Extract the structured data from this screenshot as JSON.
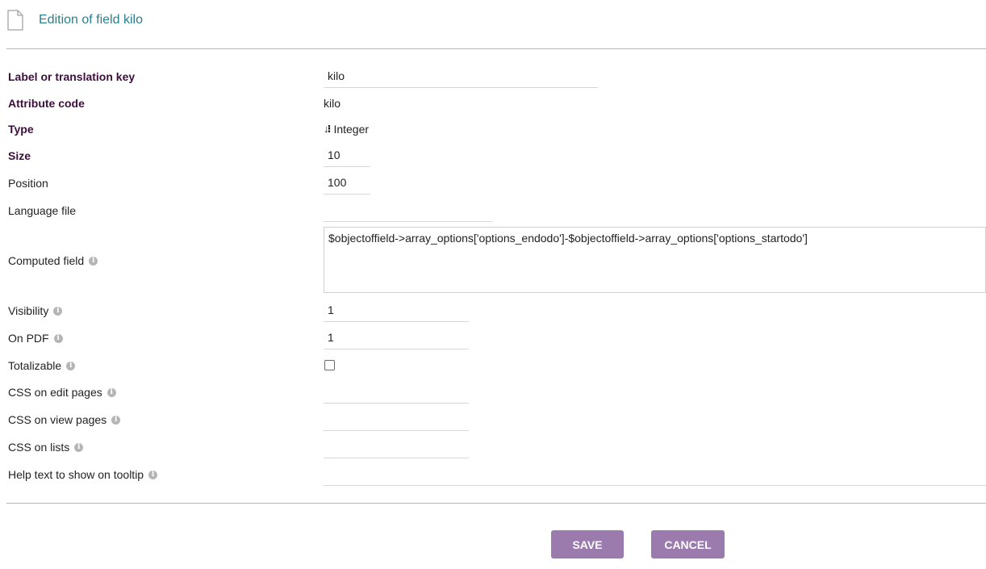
{
  "header": {
    "title": "Edition of field kilo",
    "icon": "document-icon"
  },
  "form": {
    "label_key": {
      "label": "Label or translation key",
      "value": "kilo"
    },
    "attribute_code": {
      "label": "Attribute code",
      "value": "kilo"
    },
    "type": {
      "label": "Type",
      "value": "Integer",
      "icon": "sort-numeric-icon"
    },
    "size": {
      "label": "Size",
      "value": "10"
    },
    "position": {
      "label": "Position",
      "value": "100"
    },
    "language_file": {
      "label": "Language file",
      "value": ""
    },
    "computed_field": {
      "label": "Computed field",
      "value": "$objectoffield->array_options['options_endodo']-$objectoffield->array_options['options_startodo']"
    },
    "visibility": {
      "label": "Visibility",
      "value": "1"
    },
    "on_pdf": {
      "label": "On PDF",
      "value": "1"
    },
    "totalizable": {
      "label": "Totalizable",
      "checked": false
    },
    "css_edit": {
      "label": "CSS on edit pages",
      "value": ""
    },
    "css_view": {
      "label": "CSS on view pages",
      "value": ""
    },
    "css_lists": {
      "label": "CSS on lists",
      "value": ""
    },
    "help_text": {
      "label": "Help text to show on tooltip",
      "value": ""
    }
  },
  "buttons": {
    "save": "SAVE",
    "cancel": "CANCEL"
  },
  "colors": {
    "title": "#2b7f8c",
    "required_label": "#3c0f3c",
    "button": "#9b7bae"
  }
}
